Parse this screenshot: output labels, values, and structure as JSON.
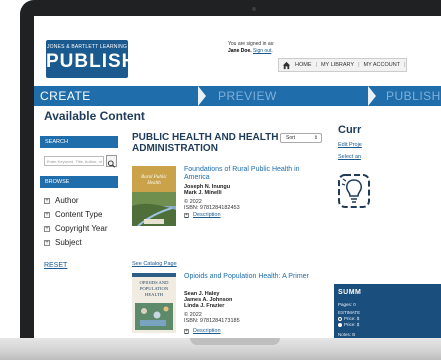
{
  "header": {
    "logo_top": "JONES & BARTLETT LEARNING",
    "logo_main": "PUBLISH",
    "signed_in_label": "You are signed in as:",
    "user_name": "Jane Doe.",
    "sign_out": "Sign out",
    "nav": [
      "HOME",
      "MY LIBRARY",
      "MY ACCOUNT"
    ]
  },
  "steps": {
    "create": "CREATE",
    "preview": "PREVIEW",
    "publish": "PUBLISH"
  },
  "sidebar": {
    "title": "Available Content",
    "search_label": "SEARCH",
    "search_placeholder": "Enter Keyword, Title, Author, or ISBN",
    "browse_label": "BROWSE",
    "facets": [
      "Author",
      "Content Type",
      "Copyright Year",
      "Subject"
    ],
    "reset": "RESET"
  },
  "main": {
    "title": "PUBLIC HEALTH AND HEALTH ADMINISTRATION",
    "sort_label": "Sort",
    "catalog_link": "See Catalog Page",
    "books": [
      {
        "title": "Foundations of Rural Public Health in America",
        "authors": [
          "Joseph N. Inungu",
          "Mark J. Minelli"
        ],
        "year": "© 2022",
        "isbn": "ISBN: 9781284182453",
        "desc": "Description",
        "cover_text": "Rural Public Health"
      },
      {
        "title": "Opioids and Population Health: A Primer",
        "authors": [
          "Sean J. Haley",
          "James A. Johnson",
          "Linda J. Frazier"
        ],
        "year": "© 2022",
        "isbn": "ISBN: 9781284173185",
        "desc": "Description",
        "cover_text": "OPIOIDS AND POPULATION HEALTH"
      }
    ]
  },
  "right": {
    "title": "Curr",
    "links": [
      "Edit Proje",
      "Select an"
    ],
    "summary_title": "SUMM",
    "pages": "Pages: 0",
    "estimate": "ESTIMATE",
    "price1": "Price: $",
    "price2": "Price: $",
    "notes": "Notes: B"
  },
  "colors": {
    "brand_blue": "#1f6dab",
    "navy": "#1a4e7d",
    "heading": "#1f3b57"
  }
}
